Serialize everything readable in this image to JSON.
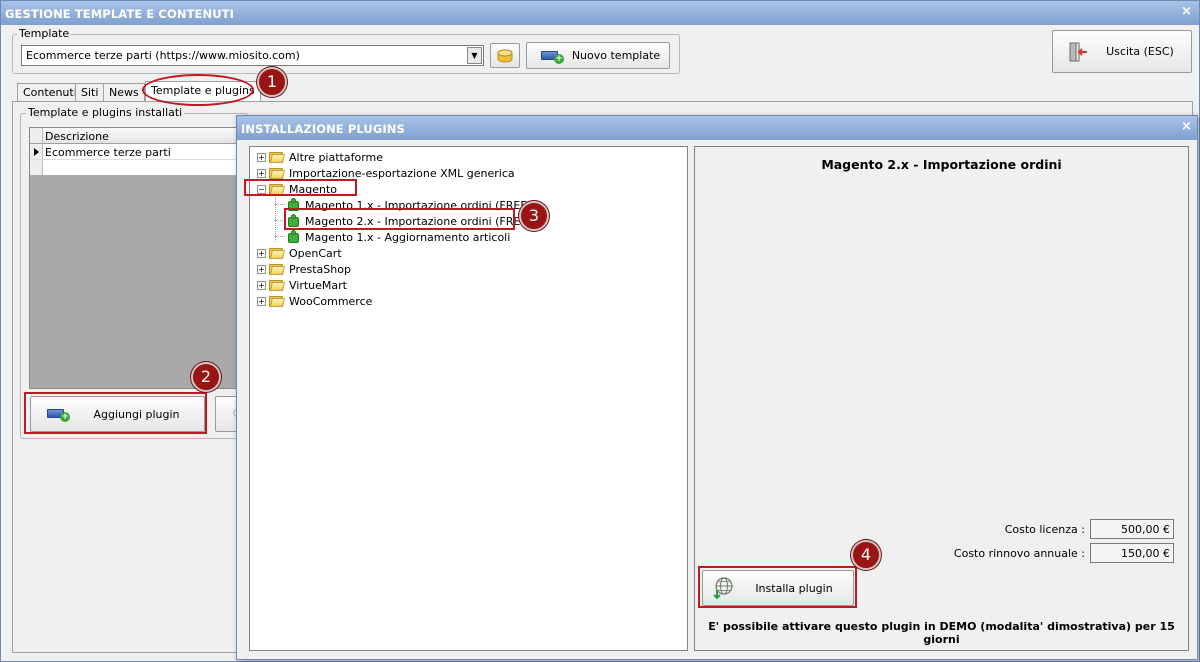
{
  "window": {
    "title": "GESTIONE TEMPLATE E CONTENUTI",
    "close_glyph": "×"
  },
  "template_group": {
    "label": "Template",
    "selected_value": "Ecommerce terze parti (https://www.miosito.com)",
    "combo_arrow": "▼",
    "new_template_label": "Nuovo template"
  },
  "exit_button": {
    "label": "Uscita (ESC)"
  },
  "tabs": [
    {
      "label": "Contenuti"
    },
    {
      "label": "Siti"
    },
    {
      "label": "News"
    },
    {
      "label": "Template e plugins",
      "active": true
    }
  ],
  "installed_group": {
    "label": "Template e plugins installati",
    "grid_header": "Descrizione",
    "rows": [
      "Ecommerce terze parti"
    ],
    "add_plugin_label": "Aggiungi plugin"
  },
  "dialog": {
    "title": "INSTALLAZIONE PLUGINS",
    "close_glyph": "×",
    "tree": {
      "collapsed_glyph": "+",
      "expanded_glyph": "−",
      "items": [
        {
          "label": "Altre piattaforme"
        },
        {
          "label": "Importazione-esportazione XML generica"
        },
        {
          "label": "Magento",
          "expanded": true,
          "children": [
            "Magento 1.x - Importazione ordini (FREE)",
            "Magento 2.x - Importazione ordini (FREE)",
            "Magento 1.x - Aggiornamento articoli"
          ]
        },
        {
          "label": "OpenCart"
        },
        {
          "label": "PrestaShop"
        },
        {
          "label": "VirtueMart"
        },
        {
          "label": "WooCommerce"
        }
      ]
    },
    "detail": {
      "title": "Magento 2.x - Importazione ordini",
      "license_label": "Costo licenza :",
      "license_value": "500,00 €",
      "renewal_label": "Costo rinnovo annuale :",
      "renewal_value": "150,00 €",
      "install_label": "Installa plugin",
      "demo_note": "E' possibile attivare questo plugin in DEMO (modalita' dimostrativa) per 15 giorni"
    }
  },
  "badges": [
    "1",
    "2",
    "3",
    "4"
  ],
  "colors": {
    "titlebar_start": "#a9c3e6",
    "titlebar_end": "#7fa0cf",
    "annotation_red": "#c0191f",
    "badge_fill": "#9a1414"
  }
}
